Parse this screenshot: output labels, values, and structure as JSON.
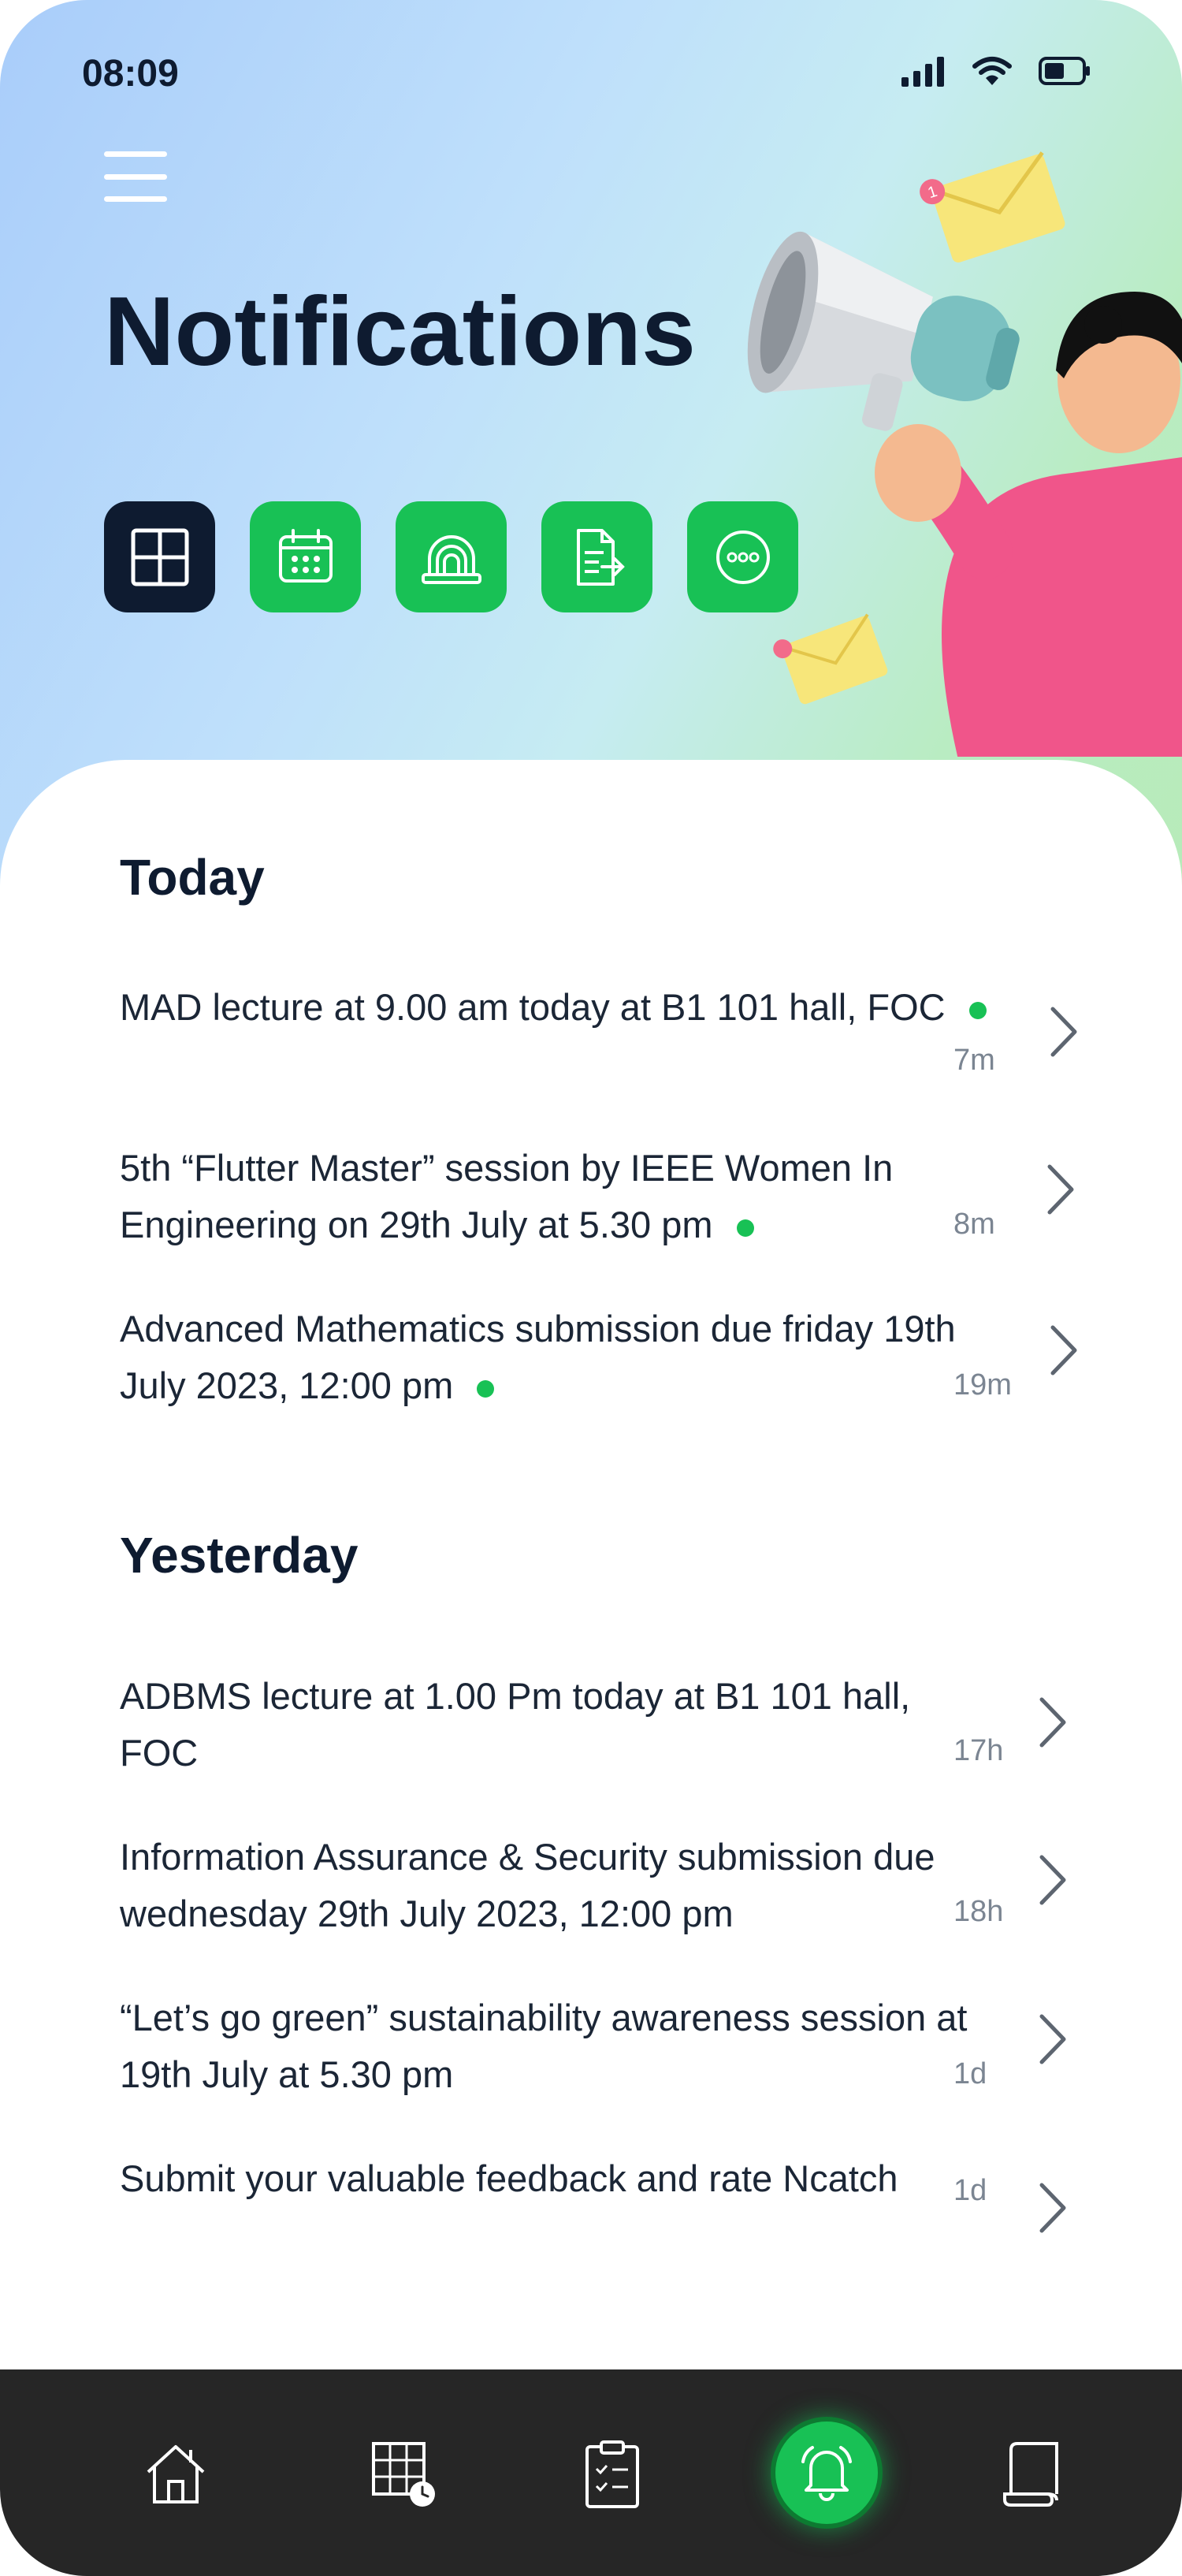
{
  "status_bar": {
    "time": "08:09"
  },
  "header": {
    "title": "Notifications",
    "envelope_badge": "1"
  },
  "filters": [
    {
      "icon": "grid-icon",
      "active": true
    },
    {
      "icon": "calendar-icon",
      "active": false
    },
    {
      "icon": "alarm-icon",
      "active": false
    },
    {
      "icon": "document-icon",
      "active": false
    },
    {
      "icon": "more-icon",
      "active": false
    }
  ],
  "sections": {
    "today": {
      "title": "Today",
      "items": [
        {
          "text": "MAD lecture at 9.00 am today at B1 101 hall, FOC",
          "time": "7m",
          "unread": true
        },
        {
          "text": "5th “Flutter Master” session by IEEE Women In Engineering on 29th July at 5.30 pm",
          "time": "8m",
          "unread": true
        },
        {
          "text": "Advanced Mathematics submission due friday 19th July 2023, 12:00 pm",
          "time": "19m",
          "unread": true
        }
      ]
    },
    "yesterday": {
      "title": "Yesterday",
      "items": [
        {
          "text": "ADBMS lecture at 1.00 Pm today at B1 101 hall, FOC",
          "time": "17h",
          "unread": false
        },
        {
          "text": "Information Assurance & Security submission due wednesday 29th July 2023, 12:00 pm",
          "time": "18h",
          "unread": false
        },
        {
          "text": "“Let’s go green” sustainability awareness session at 19th July at 5.30 pm",
          "time": "1d",
          "unread": false
        },
        {
          "text": "Submit your valuable feedback and rate Ncatch",
          "time": "1d",
          "unread": false
        }
      ]
    }
  },
  "bottom_nav": [
    {
      "icon": "home-icon"
    },
    {
      "icon": "timetable-icon"
    },
    {
      "icon": "clipboard-icon"
    },
    {
      "icon": "bell-icon",
      "active": true
    },
    {
      "icon": "scroll-icon"
    }
  ],
  "colors": {
    "accent": "#18c155",
    "dark": "#0e1b30",
    "nav_bg": "#262626",
    "muted": "#7b8592"
  }
}
